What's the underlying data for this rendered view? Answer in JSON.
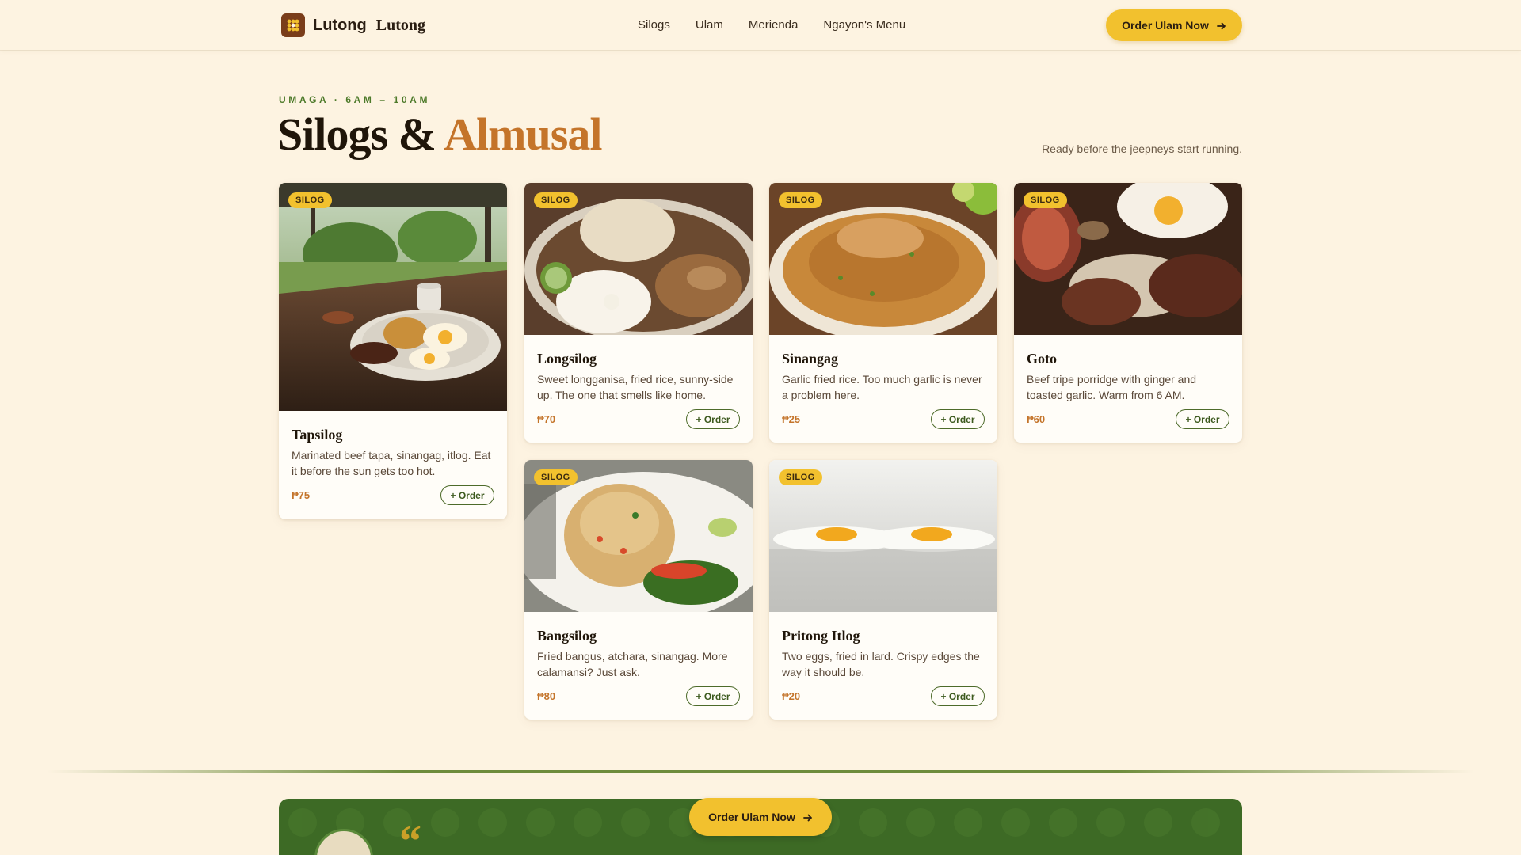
{
  "header": {
    "brand_name": "Lutong",
    "brand_name_2": "Lutong",
    "nav": [
      "Silogs",
      "Ulam",
      "Merienda",
      "Ngayon's Menu"
    ],
    "cta_label": "Order Ulam Now"
  },
  "section": {
    "eyebrow": "UMAGA · 6AM – 10AM",
    "title_main": "Silogs & ",
    "title_accent": "Almusal",
    "tagline": "Ready before the jeepneys start running."
  },
  "cards": [
    {
      "badge": "SILOG",
      "name": "Tapsilog",
      "desc": "Marinated beef tapa, sinangag, itlog. Eat it before the sun gets too hot.",
      "price": "₱75",
      "order_label": "+ Order"
    },
    {
      "badge": "SILOG",
      "name": "Longsilog",
      "desc": "Sweet longganisa, fried rice, sunny-side up. The one that smells like home.",
      "price": "₱70",
      "order_label": "+ Order"
    },
    {
      "badge": "SILOG",
      "name": "Sinangag",
      "desc": "Garlic fried rice. Too much garlic is never a problem here.",
      "price": "₱25",
      "order_label": "+ Order"
    },
    {
      "badge": "SILOG",
      "name": "Goto",
      "desc": "Beef tripe porridge with ginger and toasted garlic. Warm from 6 AM.",
      "price": "₱60",
      "order_label": "+ Order"
    },
    {
      "badge": "SILOG",
      "name": "Bangsilog",
      "desc": "Fried bangus, atchara, sinangag. More calamansi? Just ask.",
      "price": "₱80",
      "order_label": "+ Order"
    },
    {
      "badge": "SILOG",
      "name": "Pritong Itlog",
      "desc": "Two eggs, fried in lard. Crispy edges the way it should be.",
      "price": "₱20",
      "order_label": "+ Order"
    }
  ],
  "promo": {
    "cta_label": "Order Ulam Now",
    "quote_mark": "“"
  },
  "colors": {
    "background": "#fdf3e1",
    "accent_yellow": "#f2c12e",
    "accent_orange": "#c4742a",
    "green": "#3d6a25"
  }
}
